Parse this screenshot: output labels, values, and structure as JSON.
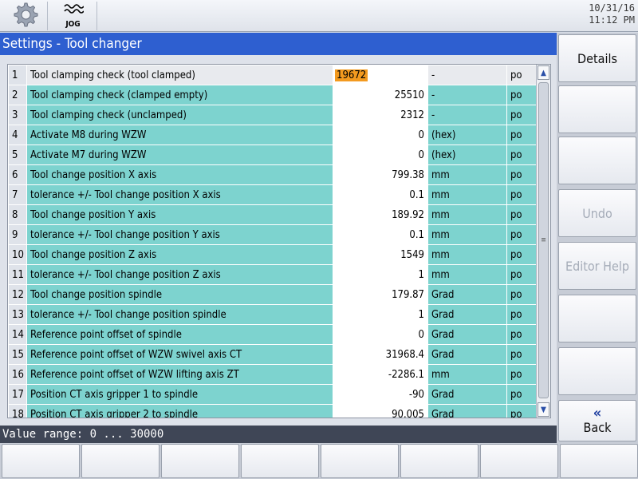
{
  "header": {
    "settings_icon": "gear-icon",
    "mode_icon": "jog-icon",
    "mode_label": "JOG",
    "date": "10/31/16",
    "time": "11:12 PM"
  },
  "title": "Settings - Tool changer",
  "table": {
    "rows": [
      {
        "num": "1",
        "desc": "Tool clamping check (tool clamped)",
        "value": "19672",
        "unit": "-",
        "access": "po"
      },
      {
        "num": "2",
        "desc": "Tool clamping check (clamped empty)",
        "value": "25510",
        "unit": "-",
        "access": "po"
      },
      {
        "num": "3",
        "desc": "Tool clamping check (unclamped)",
        "value": "2312",
        "unit": "-",
        "access": "po"
      },
      {
        "num": "4",
        "desc": "Activate M8 during WZW",
        "value": "0",
        "unit": "(hex)",
        "access": "po"
      },
      {
        "num": "5",
        "desc": "Activate M7 during WZW",
        "value": "0",
        "unit": "(hex)",
        "access": "po"
      },
      {
        "num": "6",
        "desc": "Tool change position X axis",
        "value": "799.38",
        "unit": "mm",
        "access": "po"
      },
      {
        "num": "7",
        "desc": "tolerance +/- Tool change position X axis",
        "value": "0.1",
        "unit": "mm",
        "access": "po"
      },
      {
        "num": "8",
        "desc": "Tool change position Y axis",
        "value": "189.92",
        "unit": "mm",
        "access": "po"
      },
      {
        "num": "9",
        "desc": "tolerance +/- Tool change position Y axis",
        "value": "0.1",
        "unit": "mm",
        "access": "po"
      },
      {
        "num": "10",
        "desc": "Tool change position Z axis",
        "value": "1549",
        "unit": "mm",
        "access": "po"
      },
      {
        "num": "11",
        "desc": "tolerance +/- Tool change position Z axis",
        "value": "1",
        "unit": "mm",
        "access": "po"
      },
      {
        "num": "12",
        "desc": "Tool change position spindle",
        "value": "179.87",
        "unit": "Grad",
        "access": "po"
      },
      {
        "num": "13",
        "desc": "tolerance +/- Tool change position spindle",
        "value": "1",
        "unit": "Grad",
        "access": "po"
      },
      {
        "num": "14",
        "desc": "Reference point offset of spindle",
        "value": "0",
        "unit": "Grad",
        "access": "po"
      },
      {
        "num": "15",
        "desc": "Reference point offset of WZW swivel axis CT",
        "value": "31968.4",
        "unit": "Grad",
        "access": "po"
      },
      {
        "num": "16",
        "desc": "Reference point offset of WZW lifting axis ZT",
        "value": "-2286.1",
        "unit": "mm",
        "access": "po"
      },
      {
        "num": "17",
        "desc": "Position CT axis gripper 1 to spindle",
        "value": "-90",
        "unit": "Grad",
        "access": "po"
      },
      {
        "num": "18",
        "desc": "Position CT axis gripper 2 to spindle",
        "value": "90.005",
        "unit": "Grad",
        "access": "po"
      }
    ]
  },
  "status_line": "Value range: 0 ... 30000",
  "right_softkeys": {
    "details": "Details",
    "undo": "Undo",
    "editor_help": "Editor Help",
    "back": "Back",
    "back_icon": "double-chevron-left-icon"
  },
  "colors": {
    "title_bar": "#2e5fd0",
    "row_teal": "#7dd3cf",
    "selection": "#f39a1f",
    "status_bar": "#3f4656"
  }
}
